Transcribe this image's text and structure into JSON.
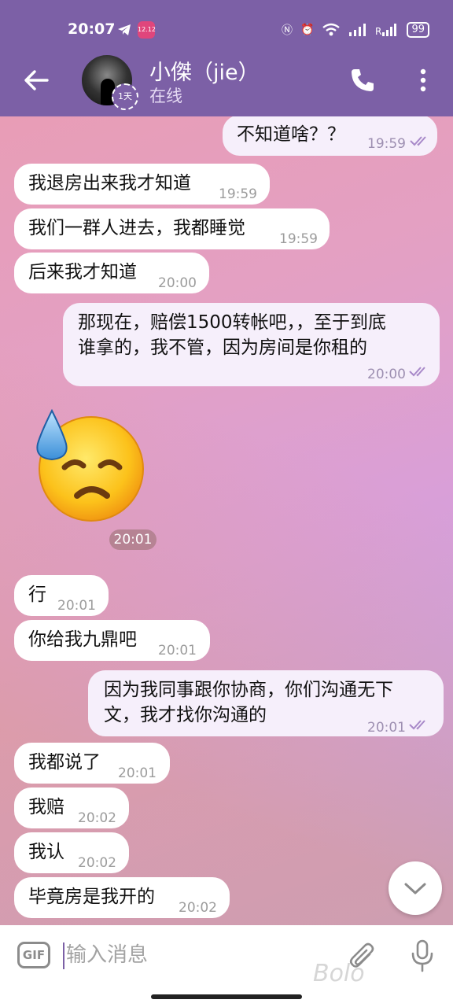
{
  "status_bar": {
    "time": "20:07",
    "app_badge": "12.12",
    "battery": "99"
  },
  "header": {
    "contact_name": "小傑（jie）",
    "status": "在线",
    "timer_badge": "1天"
  },
  "messages": [
    {
      "dir": "out",
      "text": "不知道啥？？",
      "time": "19:59"
    },
    {
      "dir": "in",
      "text": "我退房出来我才知道",
      "time": "19:59"
    },
    {
      "dir": "in",
      "text": "我们一群人进去，我都睡觉",
      "time": "19:59"
    },
    {
      "dir": "in",
      "text": "后来我才知道",
      "time": "20:00"
    },
    {
      "dir": "out",
      "line1": "那现在，赔偿1500转帐吧，，至于到底",
      "line2": "谁拿的，我不管，因为房间是你租的",
      "time": "20:00"
    },
    {
      "dir": "in",
      "sticker": "downcast-face-with-sweat-emoji",
      "time": "20:01"
    },
    {
      "dir": "in",
      "text": "行",
      "time": "20:01"
    },
    {
      "dir": "in",
      "text": "你给我九鼎吧",
      "time": "20:01"
    },
    {
      "dir": "out",
      "line1": "因为我同事跟你协商，你们沟通无下",
      "line2": "文，我才找你沟通的",
      "time": "20:01"
    },
    {
      "dir": "in",
      "text": "我都说了",
      "time": "20:01"
    },
    {
      "dir": "in",
      "text": "我赔",
      "time": "20:02"
    },
    {
      "dir": "in",
      "text": "我认",
      "time": "20:02"
    },
    {
      "dir": "in",
      "text": "毕竟房是我开的",
      "time": "20:02"
    }
  ],
  "input_bar": {
    "gif_label": "GIF",
    "placeholder": "输入消息",
    "watermark": "Bolo"
  },
  "colors": {
    "header_bg": "#7c60a6",
    "outgoing_bubble": "#f6effb",
    "incoming_bubble": "#ffffff",
    "read_ticks": "#a889c9"
  }
}
